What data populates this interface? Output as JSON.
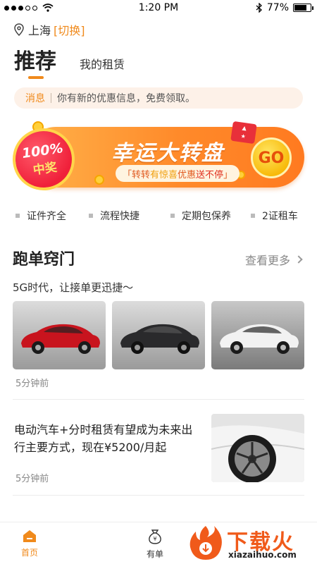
{
  "status_bar": {
    "time": "1:20 PM",
    "battery": "77%",
    "battery_level": 0.77
  },
  "location": {
    "city": "上海",
    "switch_label": "[切换]"
  },
  "tabs": {
    "active": "推荐",
    "inactive": "我的租赁"
  },
  "notice": {
    "tag": "消息",
    "message": "你有新的优惠信息，免费领取。"
  },
  "banner": {
    "badge_percent": "100%",
    "badge_text": "中奖",
    "title": "幸运大转盘",
    "sub_parts": [
      "「转转",
      "有惊喜",
      " 优惠",
      "送不停",
      "」"
    ],
    "go_label": "GO"
  },
  "features": [
    "证件齐全",
    "流程快捷",
    "定期包保养",
    "2证租车"
  ],
  "section": {
    "title": "跑单窍门",
    "more_label": "查看更多",
    "subtitle": "5G时代，让接单更迅捷～",
    "cars": [
      {
        "color": "#c8141e"
      },
      {
        "color": "#2a2a2c"
      },
      {
        "color": "#f2f2f2"
      }
    ],
    "time": "5分钟前"
  },
  "article": {
    "title": "电动汽车+分时租赁有望成为未来出行主要方式，现在¥5200/月起",
    "time": "5分钟前"
  },
  "bottom_nav": {
    "home": "首页",
    "order": "有单"
  },
  "watermark": {
    "text": "下载火",
    "url": "xiazaihuo.com"
  },
  "colors": {
    "accent": "#f08a1c"
  }
}
